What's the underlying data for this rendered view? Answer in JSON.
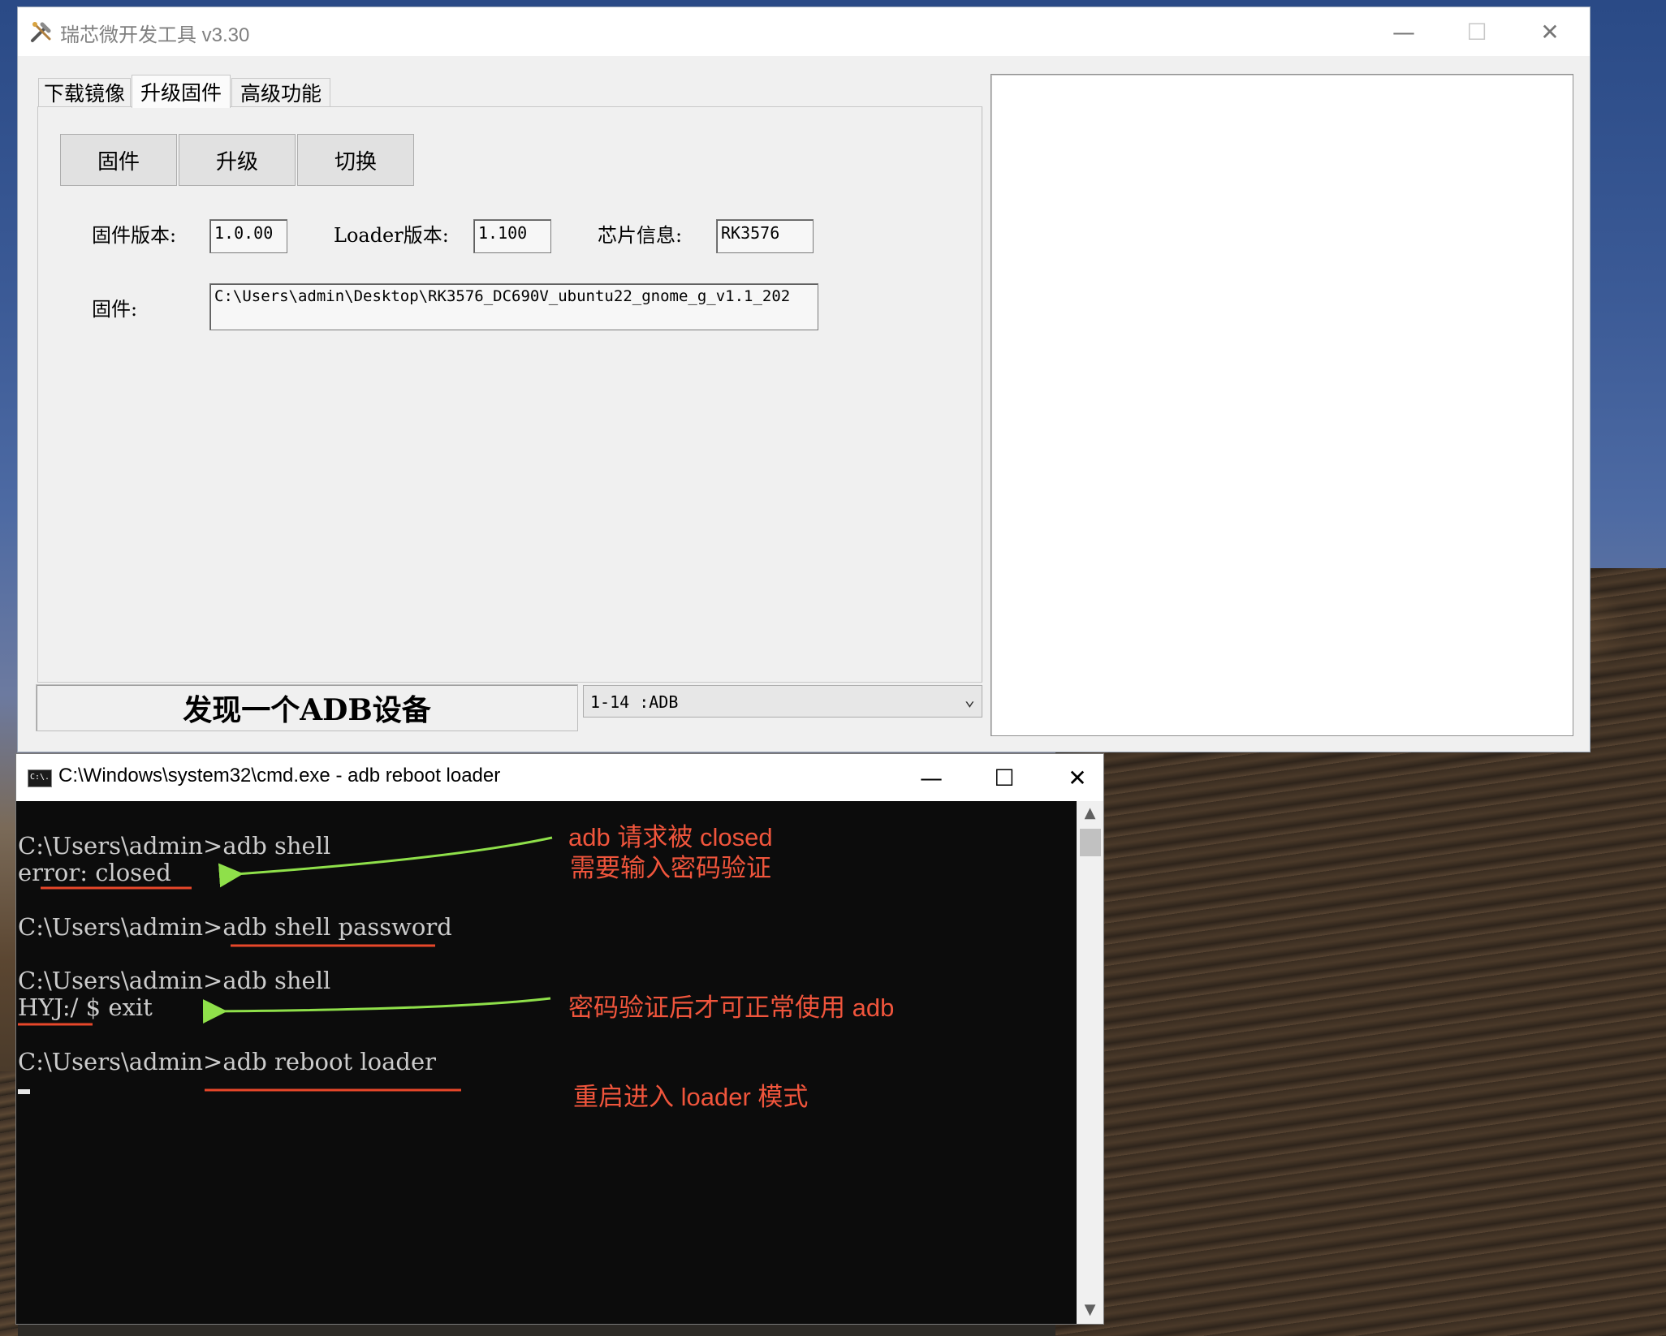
{
  "rk_tool": {
    "title": "瑞芯微开发工具 v3.30",
    "tabs": [
      "下载镜像",
      "升级固件",
      "高级功能"
    ],
    "buttons": {
      "firmware": "固件",
      "upgrade": "升级",
      "switch": "切换"
    },
    "fields": {
      "fw_version_label": "固件版本:",
      "fw_version_value": "1.0.00",
      "loader_version_label": "Loader版本:",
      "loader_version_value": "1.100",
      "chip_info_label": "芯片信息:",
      "chip_info_value": "RK3576",
      "fw_path_label": "固件:",
      "fw_path_value": "C:\\Users\\admin\\Desktop\\RK3576_DC690V_ubuntu22_gnome_g_v1.1_202"
    },
    "status": "发现一个ADB设备",
    "device_select": "1-14  :ADB"
  },
  "cmd": {
    "title": "C:\\Windows\\system32\\cmd.exe - adb  reboot loader",
    "icon_text": "C:\\.",
    "lines": [
      "C:\\Users\\admin>adb shell",
      "error: closed",
      "C:\\Users\\admin>adb shell password",
      "C:\\Users\\admin>adb shell",
      "HYJ:/ $ exit",
      "C:\\Users\\admin>adb reboot loader"
    ]
  },
  "annotations": {
    "closed_note_1": "adb 请求被 closed",
    "closed_note_2": "需要输入密码验证",
    "verified_note": "密码验证后才可正常使用 adb",
    "reboot_note": "重启进入 loader 模式"
  },
  "colors": {
    "annotation_text": "#f0553c",
    "annotation_arrow": "#8fe04a",
    "terminal_bg": "#0c0c0c"
  },
  "icons": {
    "window_minimize": "—",
    "window_maximize": "☐",
    "window_close": "✕",
    "dropdown": "⌄",
    "scroll_up": "▲",
    "scroll_down": "▼"
  }
}
